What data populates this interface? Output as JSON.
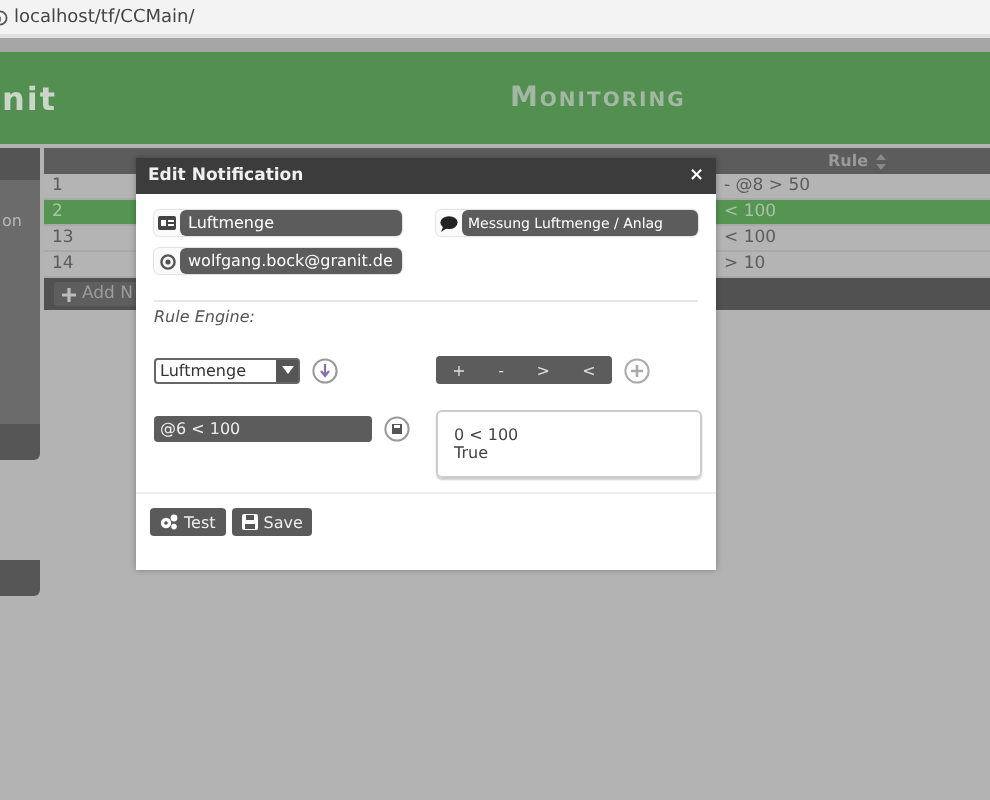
{
  "browser": {
    "address": "localhost/tf/CCMain/"
  },
  "header": {
    "logo": "nit",
    "title": "Monitoring"
  },
  "sidebar": {
    "items": [
      {
        "label": "on"
      }
    ]
  },
  "table": {
    "columns": [
      "Rule"
    ],
    "rows": [
      {
        "id": "1",
        "rule": "- @8 > 50",
        "selected": false
      },
      {
        "id": "2",
        "rule": "< 100",
        "selected": true
      },
      {
        "id": "13",
        "rule": "< 100",
        "selected": false
      },
      {
        "id": "14",
        "rule": "> 10",
        "selected": false
      }
    ]
  },
  "add_button": "Add N",
  "dialog": {
    "title": "Edit Notification",
    "close": "×",
    "name_field": {
      "value": "Luftmenge"
    },
    "description_field": {
      "value": "Messung Luftmenge / Anlag"
    },
    "email_field": {
      "value": "wolfgang.bock@granit.de"
    },
    "section_label": "Rule Engine:",
    "variable_select": {
      "value": "Luftmenge"
    },
    "operators": [
      "+",
      "-",
      ">",
      "<"
    ],
    "expression_field": {
      "value": "@6 < 100"
    },
    "result": [
      "0 < 100",
      "True"
    ],
    "buttons": [
      {
        "label": "Test",
        "kind": "test"
      },
      {
        "label": "Save",
        "kind": "save"
      }
    ]
  }
}
